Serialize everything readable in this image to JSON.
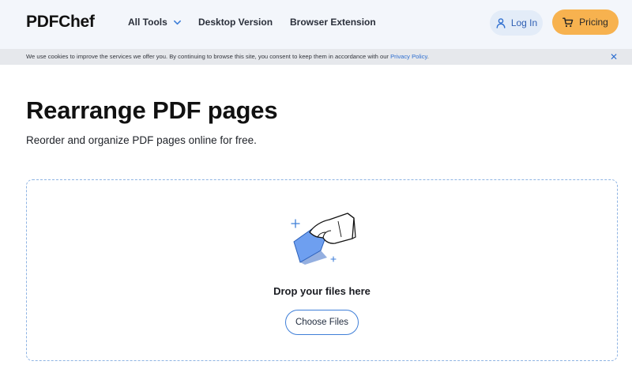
{
  "header": {
    "logo": "PDFChef",
    "nav": {
      "all_tools": "All Tools",
      "desktop_version": "Desktop Version",
      "browser_extension": "Browser Extension"
    },
    "login_label": "Log In",
    "pricing_label": "Pricing"
  },
  "cookie_bar": {
    "text": "We use cookies to improve the services we offer you. By continuing to browse this site, you consent to keep them in accordance with our ",
    "link": "Privacy Policy",
    "suffix": ".",
    "close": "✕"
  },
  "main": {
    "title": "Rearrange PDF pages",
    "subtitle": "Reorder and organize PDF pages online for free.",
    "dropzone": {
      "prompt": "Drop your files here",
      "button": "Choose Files"
    }
  },
  "colors": {
    "accent_blue": "#3f7fd8",
    "pricing_orange": "#f7b24f",
    "header_bg": "#f3f6fb",
    "cookie_bg": "#e6e8ec"
  }
}
